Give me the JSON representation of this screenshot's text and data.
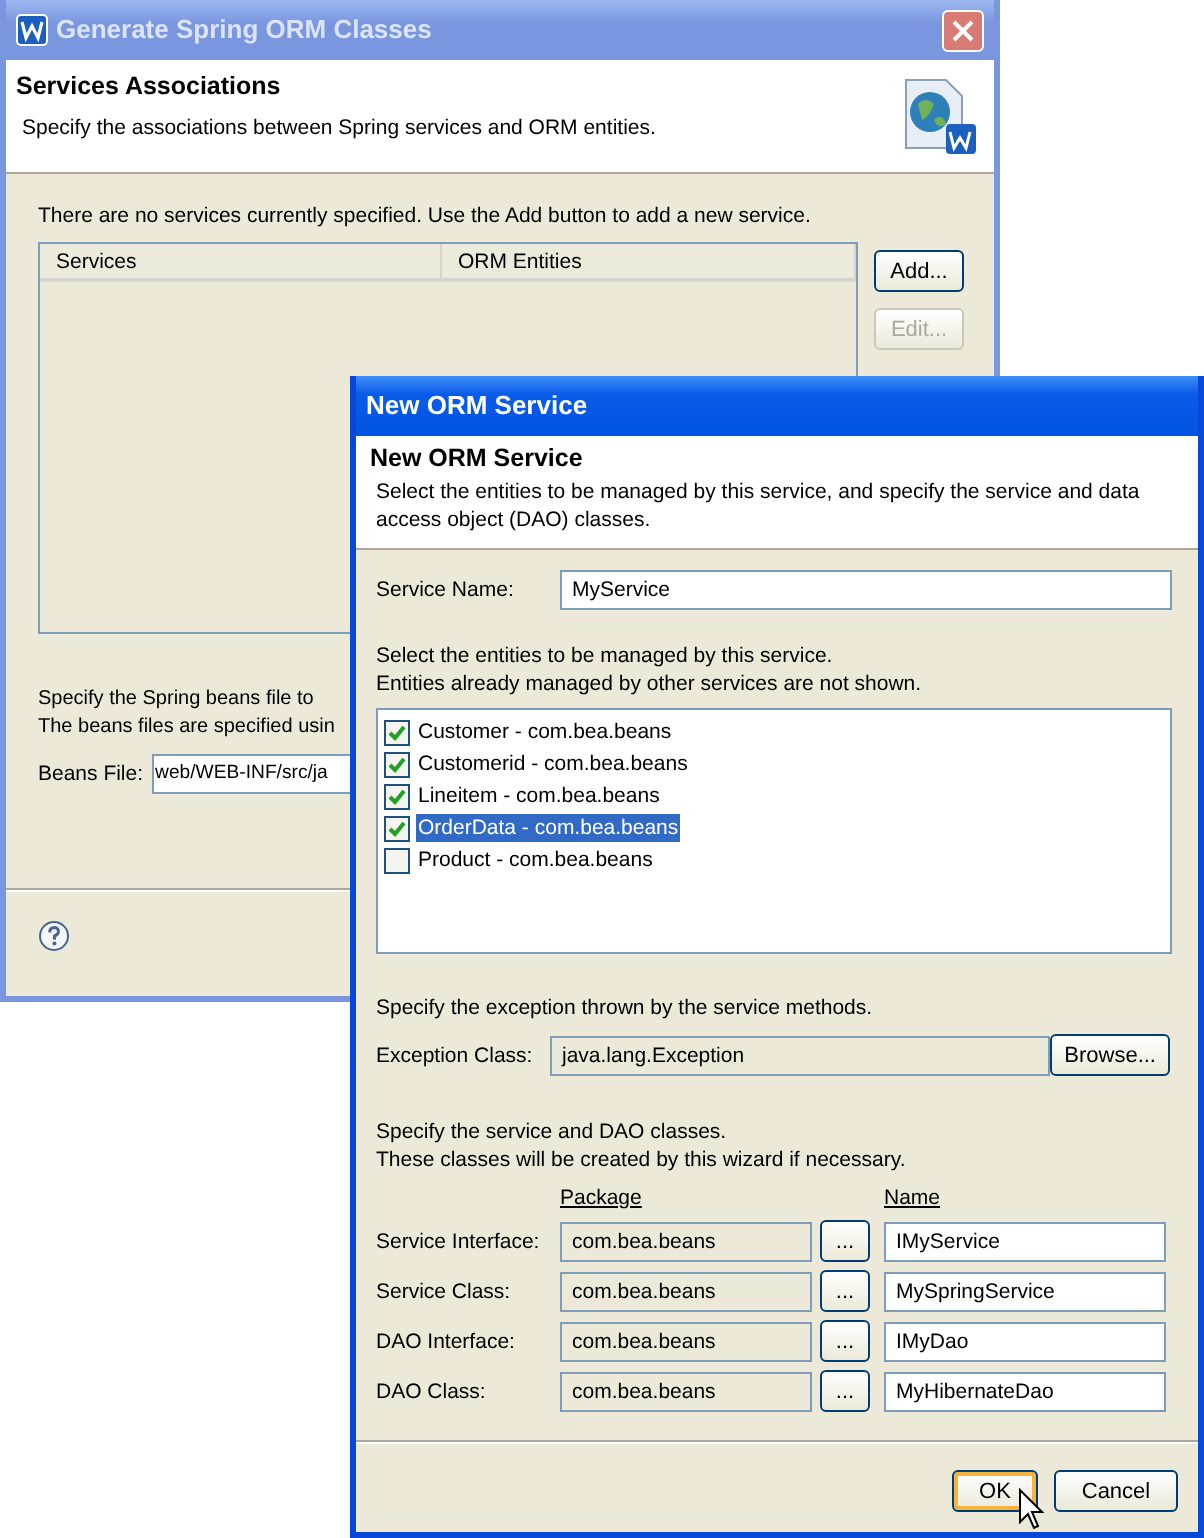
{
  "background_window": {
    "title": "Generate Spring ORM Classes",
    "header": {
      "title": "Services Associations",
      "description": "Specify the associations between Spring services and ORM entities."
    },
    "message": "There are no services currently specified. Use the Add button to add a new service.",
    "table": {
      "columns": [
        "Services",
        "ORM Entities"
      ]
    },
    "buttons": [
      {
        "label": "Add...",
        "disabled": false
      },
      {
        "label": "Edit...",
        "disabled": true
      }
    ],
    "beans_text": [
      "Specify the Spring beans file to",
      "The beans files are specified usin"
    ],
    "beans_file": {
      "label": "Beans File:",
      "value": "web/WEB-INF/src/ja"
    }
  },
  "dialog": {
    "title": "New ORM Service",
    "header": {
      "title": "New ORM Service",
      "description": "Select the entities to be managed by this service, and specify the service and data access object (DAO) classes."
    },
    "service_name": {
      "label": "Service Name:",
      "value": "MyService"
    },
    "entities_text": [
      "Select the entities to be managed by this service.",
      "Entities already managed by other services are not shown."
    ],
    "entities": [
      {
        "label": "Customer - com.bea.beans",
        "checked": true,
        "selected": false
      },
      {
        "label": "Customerid - com.bea.beans",
        "checked": true,
        "selected": false
      },
      {
        "label": "Lineitem - com.bea.beans",
        "checked": true,
        "selected": false
      },
      {
        "label": "OrderData - com.bea.beans",
        "checked": true,
        "selected": true
      },
      {
        "label": "Product - com.bea.beans",
        "checked": false,
        "selected": false
      }
    ],
    "exception_text": "Specify the exception thrown by the service methods.",
    "exception_class": {
      "label": "Exception Class:",
      "value": "java.lang.Exception",
      "editable": false,
      "button": "Browse..."
    },
    "classes_text": [
      "Specify the service and DAO classes.",
      "These classes will be created by this wizard if necessary."
    ],
    "columns": [
      "Package",
      "Name"
    ],
    "classes": [
      {
        "label": "Service Interface:",
        "package": "com.bea.beans",
        "button": "...",
        "name": "IMyService"
      },
      {
        "label": "Service Class:",
        "package": "com.bea.beans",
        "button": "...",
        "name": "MySpringService"
      },
      {
        "label": "DAO Interface:",
        "package": "com.bea.beans",
        "button": "...",
        "name": "IMyDao"
      },
      {
        "label": "DAO Class:",
        "package": "com.bea.beans",
        "button": "...",
        "name": "MyHibernateDao"
      }
    ],
    "buttons": [
      {
        "label": "OK",
        "default": true
      },
      {
        "label": "Cancel",
        "default": false
      }
    ]
  }
}
